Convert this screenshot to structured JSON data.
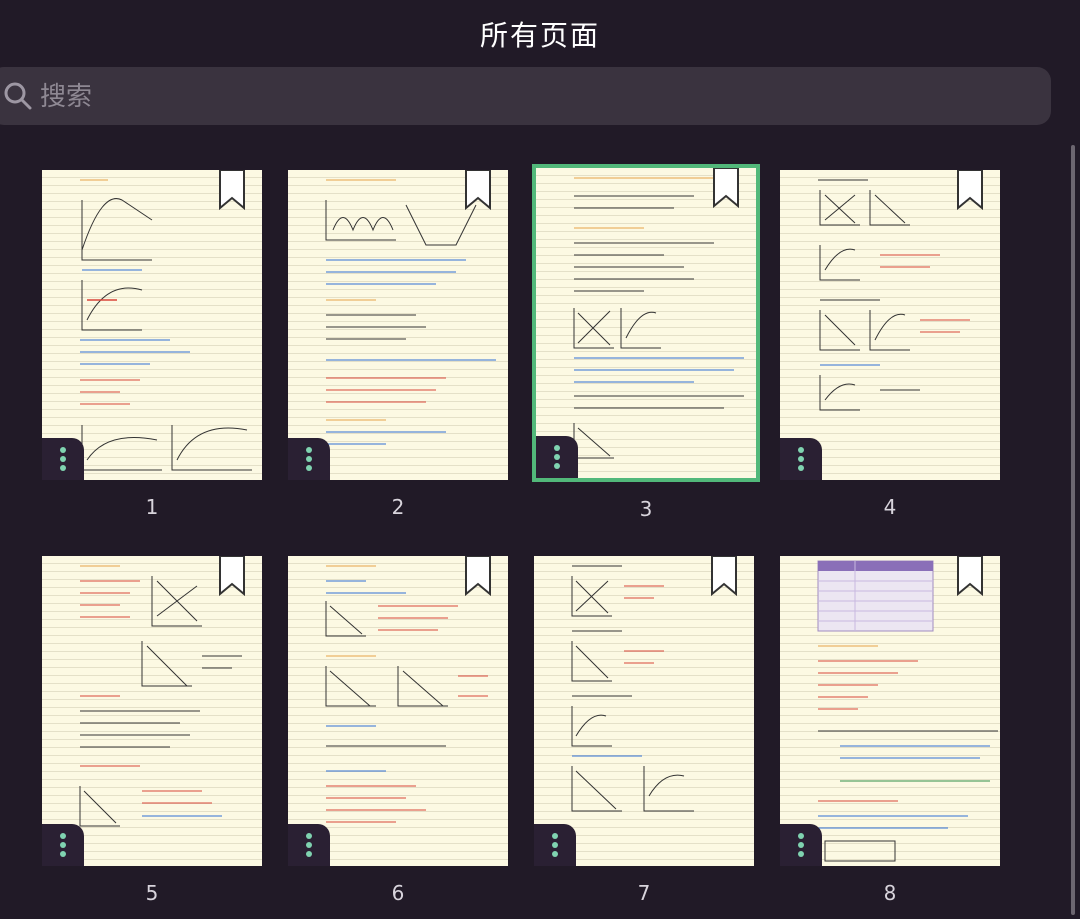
{
  "header": {
    "title": "所有页面"
  },
  "search": {
    "placeholder": "搜索",
    "value": ""
  },
  "pages": [
    {
      "number": "1",
      "selected": false
    },
    {
      "number": "2",
      "selected": false
    },
    {
      "number": "3",
      "selected": true
    },
    {
      "number": "4",
      "selected": false
    },
    {
      "number": "5",
      "selected": false
    },
    {
      "number": "6",
      "selected": false
    },
    {
      "number": "7",
      "selected": false
    },
    {
      "number": "8",
      "selected": false
    }
  ],
  "colors": {
    "background": "#211a27",
    "search_bg": "#3a333f",
    "selected_outline": "#52b87a",
    "menu_dots": "#7fd3b0",
    "page_bg": "#fcf9e3"
  },
  "icons": {
    "search": "search-icon",
    "bookmark": "bookmark-icon",
    "page_menu": "more-vertical-icon"
  }
}
